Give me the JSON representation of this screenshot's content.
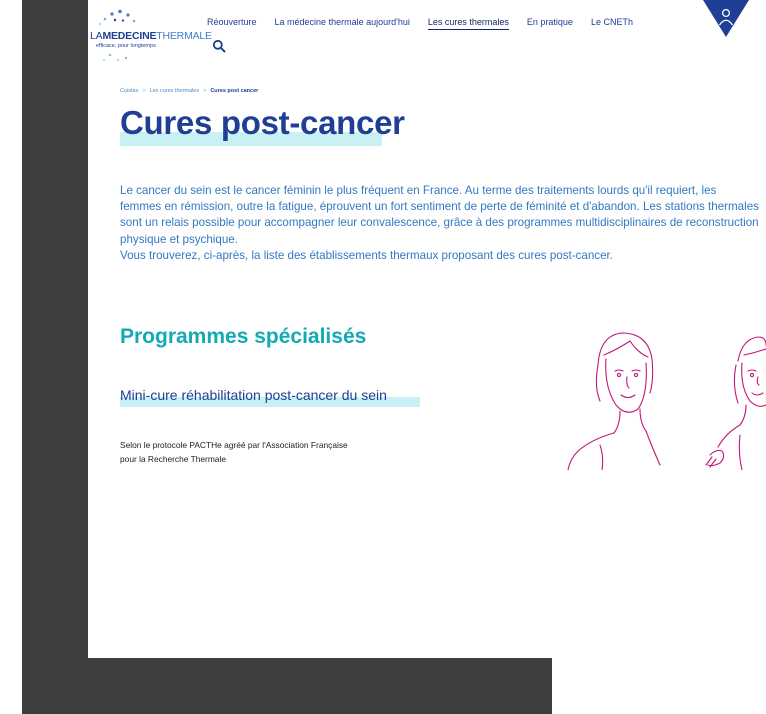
{
  "header": {
    "logo": {
      "brand_left": "LA",
      "brand_bold": "MEDECINE",
      "brand_right": "THERMALE",
      "tagline": "efficace, pour longtemps"
    },
    "nav": [
      {
        "label": "Réouverture",
        "active": false
      },
      {
        "label": "La médecine thermale aujourd'hui",
        "active": false
      },
      {
        "label": "Les cures thermales",
        "active": true
      },
      {
        "label": "En pratique",
        "active": false
      },
      {
        "label": "Le CNETh",
        "active": false
      }
    ],
    "search_icon": "search-icon",
    "user_icon": "user-icon"
  },
  "breadcrumb": [
    "Cuistas",
    "Les cures thermales",
    "Cures post cancer"
  ],
  "page": {
    "title": "Cures post-cancer",
    "intro_paragraph": "Le cancer du sein est le cancer féminin le plus fréquent en France. Au terme des traitements lourds qu'il requiert, les femmes en rémission, outre la fatigue, éprouvent un fort sentiment de perte de féminité et d'abandon. Les stations thermales sont un relais possible pour accompagner leur convalescence, grâce à des programmes multidisciplinaires de reconstruction physique et psychique.",
    "intro_line": "Vous trouverez, ci-après, la liste des établissements thermaux proposant des cures post-cancer.",
    "section_title": "Programmes spécialisés",
    "subsection_title": "Mini-cure réhabilitation post-cancer du sein",
    "protocol_line1": "Selon le protocole PACTHe agréé par l'Association Française",
    "protocol_line2": "pour la Recherche Thermale"
  },
  "colors": {
    "navy": "#1e3f94",
    "blue_text": "#3278c4",
    "teal": "#14aab4",
    "highlight": "#c9f1f3",
    "illustration": "#c4147a",
    "dark_frame": "#3f3f3f"
  }
}
